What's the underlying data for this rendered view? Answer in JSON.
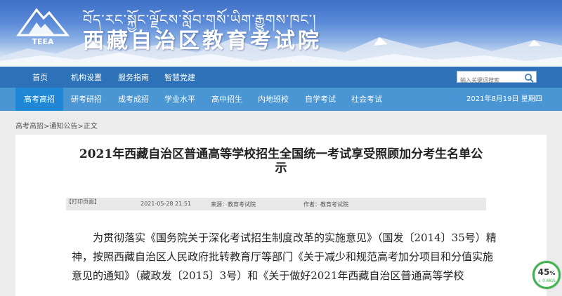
{
  "header": {
    "logo_text": "TEEA",
    "tibetan_title": "བོད་རང་སྐྱོང་ལྗོངས་སློབ་གསོ་ཡིག་རྒྱུགས་ཁང་།",
    "title": "西藏自治区教育考试院"
  },
  "nav_primary": {
    "items": [
      "首页",
      "机构设置",
      "服务指南",
      "智慧党建"
    ],
    "search_placeholder": "输入关键词搜索"
  },
  "nav_secondary": {
    "items": [
      "高考高招",
      "研考研招",
      "成考成招",
      "学业水平",
      "高中招生",
      "内地班校",
      "自学考试",
      "社会考试"
    ],
    "active_index": 0,
    "date": "2021年8月19日  星期四"
  },
  "breadcrumb": {
    "parts": [
      "高考高招",
      "通知公告",
      "正文"
    ],
    "sep": ">"
  },
  "article": {
    "title": "2021年西藏自治区普通高等学校招生全国统一考试享受照顾加分考生名单公示",
    "datetime": "2021-05-28 21:51",
    "source": "来源：教育考试院",
    "author": "作者：教育考试院",
    "print": "【打印页面】",
    "body": "为贯彻落实《国务院关于深化考试招生制度改革的实施意见》（国发〔2014〕35号）精神，按照西藏自治区人民政府批转教育厅等部门《关于减少和规范高考加分项目和分值实施意见的通知》（藏政发〔2015〕3号）和《关于做好2021年西藏自治区普通高等学校"
  },
  "speed_widget": {
    "percent": "45",
    "percent_sign": "%",
    "rate": "↓ 0.6K/s"
  },
  "colors": {
    "nav_primary_bg": "#2d72b8",
    "nav_secondary_bg": "#4a95d4",
    "active_tab_bg": "#1f88d6",
    "speed_ring": "#3fb34f"
  }
}
